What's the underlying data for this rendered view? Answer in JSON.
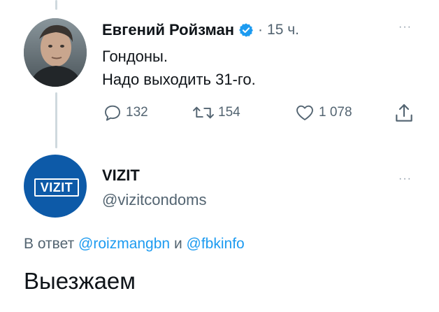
{
  "tweet1": {
    "author_name": "Евгений Ройзман",
    "verified_icon": "verified-badge-icon",
    "separator": "·",
    "time": "15 ч.",
    "more_icon": "more-dots-icon",
    "more_text": "···",
    "lines": [
      "Гондоны.",
      "Надо выходить 31-го."
    ],
    "actions": {
      "reply_icon": "reply-icon",
      "reply_count": "132",
      "retweet_icon": "retweet-icon",
      "retweet_count": "154",
      "like_icon": "heart-icon",
      "like_count": "1 078",
      "share_icon": "share-icon"
    }
  },
  "tweet2": {
    "avatar_logo_text": "VIZIT",
    "author_name": "VIZIT",
    "handle": "@vizitcondoms",
    "more_icon": "more-dots-icon",
    "more_text": "···",
    "reply_prefix": "В ответ",
    "mention1": "@roizmangbn",
    "reply_and": "и",
    "mention2": "@fbkinfo",
    "text": "Выезжаем"
  },
  "colors": {
    "accent": "#1d9bf0",
    "secondary_text": "#536471",
    "primary_text": "#0f1419",
    "thread_line": "#cfd9de",
    "vizit_brand": "#0d5aa8"
  }
}
